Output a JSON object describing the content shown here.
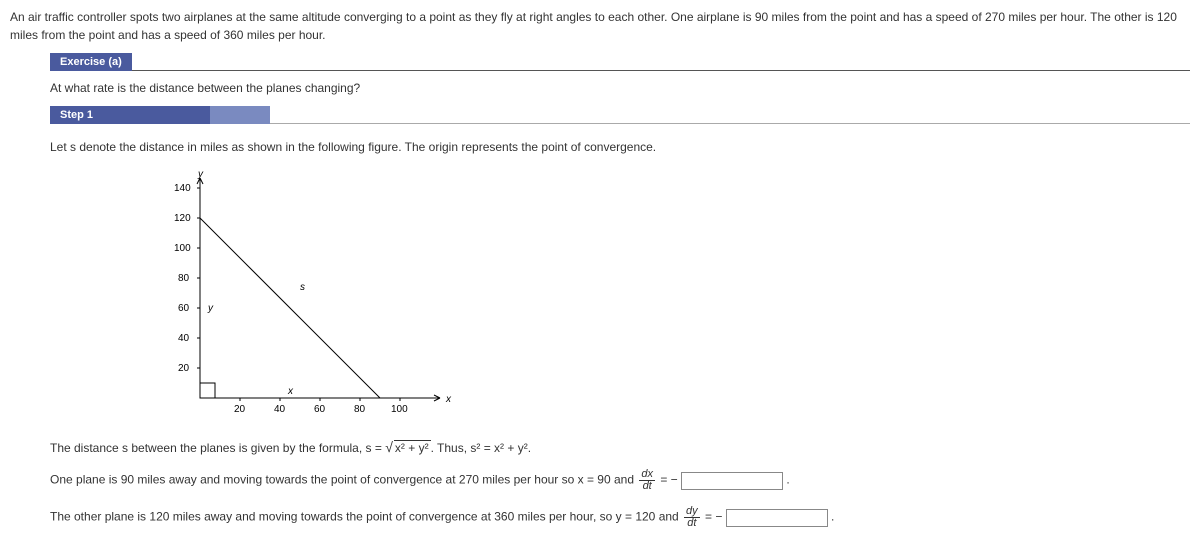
{
  "intro": "An air traffic controller spots two airplanes at the same altitude converging to a point as they fly at right angles to each other. One airplane is 90 miles from the point and has a speed of 270 miles per hour. The other is 120 miles from the point and has a speed of 360 miles per hour.",
  "exercise": {
    "tab": "Exercise (a)",
    "question": "At what rate is the distance between the planes changing?"
  },
  "step": {
    "tab": "Step 1",
    "lead": "Let s denote the distance in miles as shown in the following figure. The origin represents the point of convergence.",
    "formula_pre": "The distance s between the planes is given by the formula, s = ",
    "formula_sqrt": "x² + y²",
    "formula_post": ". Thus, s² = x² + y².",
    "plane1_pre": "One plane is 90 miles away and moving towards the point of convergence at 270 miles per hour so x = 90 and ",
    "plane1_frac_num": "dx",
    "plane1_frac_den": "dt",
    "plane1_eq": " = − ",
    "plane2_pre": "The other plane is 120 miles away and moving towards the point of convergence at 360 miles per hour, so y = 120 and ",
    "plane2_frac_num": "dy",
    "plane2_frac_den": "dt",
    "plane2_eq": " = − "
  },
  "chart_data": {
    "type": "line",
    "title": "",
    "xlabel": "x",
    "ylabel": "y",
    "xlim": [
      0,
      110
    ],
    "ylim": [
      0,
      150
    ],
    "x_ticks": [
      20,
      40,
      60,
      80,
      100
    ],
    "y_ticks": [
      20,
      40,
      60,
      80,
      100,
      120,
      140
    ],
    "series": [
      {
        "name": "s",
        "x": [
          0,
          90
        ],
        "y": [
          120,
          0
        ]
      }
    ],
    "annotations": [
      {
        "text": "s",
        "x": 45,
        "y": 80
      },
      {
        "text": "y",
        "x": 8,
        "y": 60
      },
      {
        "text": "x",
        "x": 45,
        "y": -6
      }
    ]
  }
}
